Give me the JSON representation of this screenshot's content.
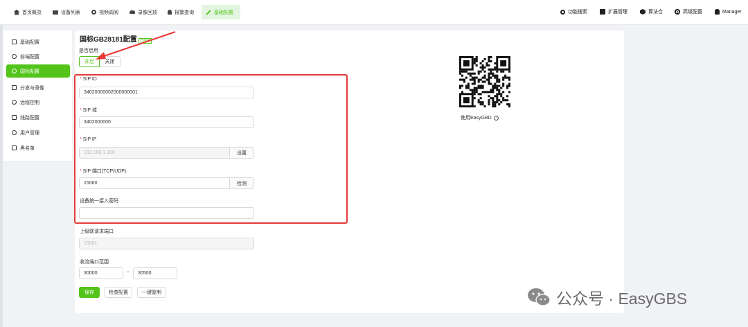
{
  "nav": {
    "items": [
      {
        "label": "首页概览",
        "icon": "home-icon"
      },
      {
        "label": "设备列表",
        "icon": "video-icon"
      },
      {
        "label": "视频调阅",
        "icon": "play-circle-icon"
      },
      {
        "label": "录像回放",
        "icon": "cloud-icon"
      },
      {
        "label": "报警查询",
        "icon": "bell-icon"
      },
      {
        "label": "基础配置",
        "icon": "edit-icon"
      }
    ],
    "right": [
      {
        "label": "功能搜索",
        "icon": "search-icon"
      },
      {
        "label": "扩展管理",
        "icon": "puzzle-icon"
      },
      {
        "label": "算法仓",
        "icon": "box-icon"
      },
      {
        "label": "高级配置",
        "icon": "gear-icon"
      },
      {
        "label": "Manager",
        "icon": "user-icon"
      }
    ],
    "active_color": "#52c41a"
  },
  "sidebar": {
    "items": [
      {
        "label": "基础配置",
        "icon": "file-icon"
      },
      {
        "label": "前端配置",
        "icon": "compass-icon"
      },
      {
        "label": "国标配置",
        "icon": "settings-icon"
      },
      {
        "label": "分发与录像",
        "icon": "share-icon"
      },
      {
        "label": "远程控制",
        "icon": "remote-icon"
      },
      {
        "label": "线路配置",
        "icon": "route-icon"
      },
      {
        "label": "用户管理",
        "icon": "users-icon"
      },
      {
        "label": "黑名单",
        "icon": "list-icon"
      }
    ]
  },
  "form": {
    "title": "国标GB28181配置",
    "title_tag": "已连接",
    "enable_label": "是否启用",
    "enable_on": "开启",
    "enable_off": "关闭",
    "sip_id_label": "SIP ID",
    "sip_id_value": "34020000002000000001",
    "sip_domain_label": "SIP 域",
    "sip_domain_value": "3402000000",
    "sip_ip_label": "SIP IP",
    "sip_ip_value": "192.168.1.160",
    "sip_ip_button": "设置",
    "sip_port_label": "SIP 端口(TCP/UDP)",
    "sip_port_value": "15060",
    "sip_port_button": "检测",
    "password_label": "设备统一接入密码",
    "password_value": "",
    "upper_port_label": "上级联请求端口",
    "upper_port_value": "15061",
    "range_label": "收流端口范围",
    "range_start": "30000",
    "range_sep": "~",
    "range_end": "30500",
    "save": "保存",
    "check": "检查配置",
    "copy": "一键复制"
  },
  "qr": {
    "caption": "使用EasyGBD"
  },
  "watermark": {
    "text": "公众号 · EasyGBS"
  },
  "colors": {
    "accent": "#52c41a",
    "highlight": "#e53935"
  }
}
